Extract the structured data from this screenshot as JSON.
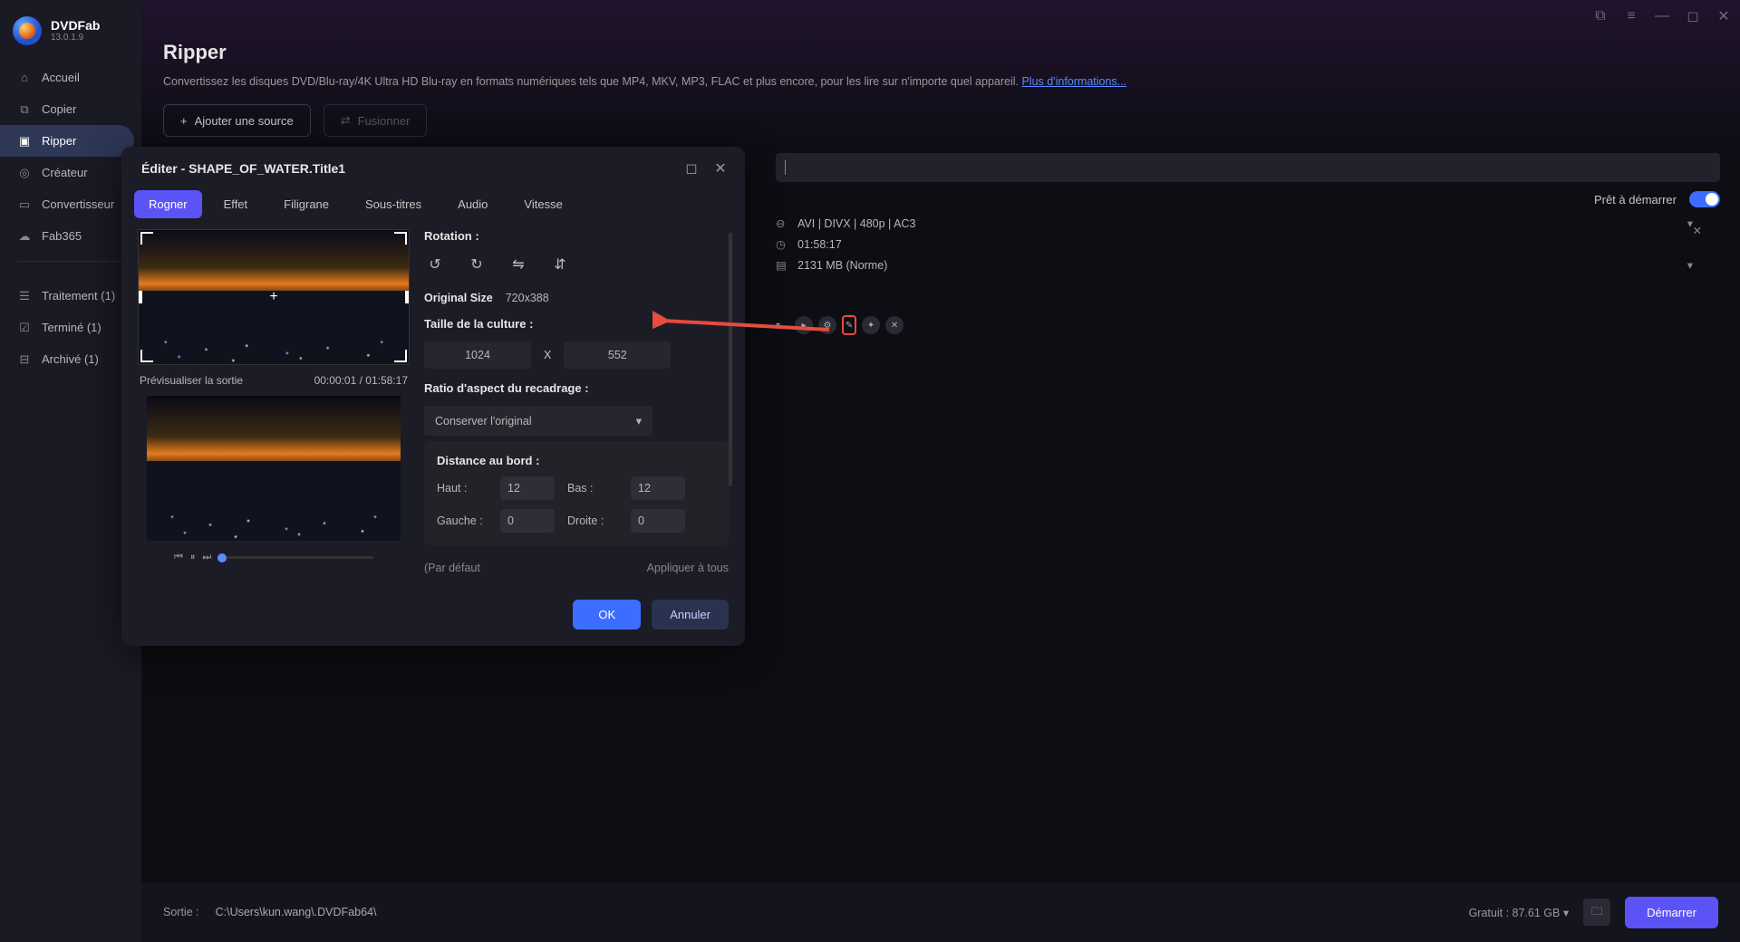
{
  "app": {
    "name": "DVDFab",
    "version": "13.0.1.9"
  },
  "sidebar": {
    "items": [
      {
        "label": "Accueil",
        "icon": "home"
      },
      {
        "label": "Copier",
        "icon": "copy"
      },
      {
        "label": "Ripper",
        "icon": "ripper"
      },
      {
        "label": "Créateur",
        "icon": "create"
      },
      {
        "label": "Convertisseur",
        "icon": "convert"
      },
      {
        "label": "Fab365",
        "icon": "cloud"
      }
    ],
    "status": [
      {
        "label": "Traitement (1)",
        "icon": "list"
      },
      {
        "label": "Terminé (1)",
        "icon": "check"
      },
      {
        "label": "Archivé (1)",
        "icon": "archive"
      }
    ]
  },
  "header": {
    "title": "Ripper",
    "desc": "Convertissez les disques DVD/Blu-ray/4K Ultra HD Blu-ray en formats numériques tels que MP4, MKV, MP3, FLAC et plus encore, pour les lire sur n'importe quel appareil. ",
    "more": "Plus d'informations...",
    "add_src": "Ajouter une source",
    "merge": "Fusionner"
  },
  "row": {
    "ready": "Prêt à démarrer",
    "format": "AVI | DIVX | 480p | AC3",
    "duration": "01:58:17",
    "size": "2131 MB (Norme)"
  },
  "modal": {
    "title": "Éditer - SHAPE_OF_WATER.Title1",
    "tabs": [
      "Rogner",
      "Effet",
      "Filigrane",
      "Sous-titres",
      "Audio",
      "Vitesse"
    ],
    "preview_label": "Prévisualiser la sortie",
    "timecode": "00:00:01 / 01:58:17",
    "rotation_label": "Rotation :",
    "orig_size_label": "Original Size",
    "orig_size_value": "720x388",
    "crop_size_label": "Taille de la culture :",
    "crop_w": "1024",
    "crop_x": "X",
    "crop_h": "552",
    "aspect_label": "Ratio d'aspect du recadrage :",
    "aspect_value": "Conserver l'original",
    "edge_label": "Distance au bord :",
    "edge": {
      "top_l": "Haut :",
      "top_v": "12",
      "bot_l": "Bas :",
      "bot_v": "12",
      "left_l": "Gauche :",
      "left_v": "0",
      "right_l": "Droite :",
      "right_v": "0"
    },
    "default_label": "(Par défaut",
    "apply_all": "Appliquer à tous",
    "ok": "OK",
    "cancel": "Annuler"
  },
  "footer": {
    "out_label": "Sortie :",
    "out_path": "C:\\Users\\kun.wang\\.DVDFab64\\",
    "free_label": "Gratuit : 87.61 GB",
    "start": "Démarrer"
  }
}
